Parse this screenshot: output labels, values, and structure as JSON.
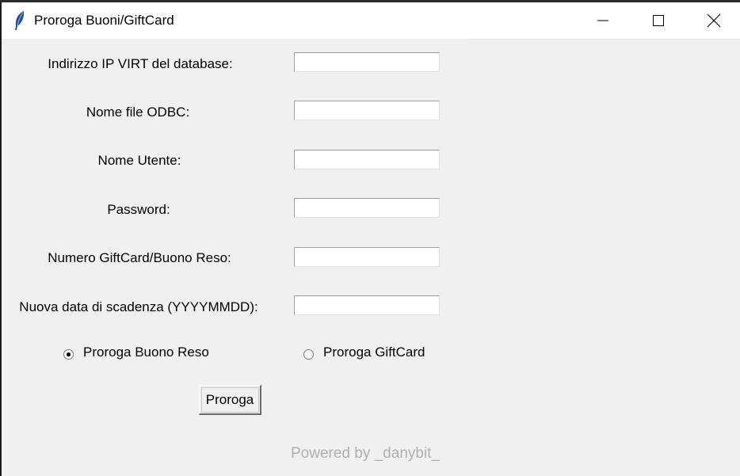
{
  "window": {
    "title": "Proroga Buoni/GiftCard",
    "icon": "feather-icon",
    "controls": [
      "minimize-icon",
      "maximize-icon",
      "close-icon"
    ]
  },
  "form": {
    "fields": [
      {
        "label": "Indirizzo IP VIRT del database:",
        "value": ""
      },
      {
        "label": "Nome file ODBC:",
        "value": ""
      },
      {
        "label": "Nome Utente:",
        "value": ""
      },
      {
        "label": "Password:",
        "value": ""
      },
      {
        "label": "Numero GiftCard/Buono Reso:",
        "value": ""
      },
      {
        "label": "Nuova data di scadenza (YYYYMMDD):",
        "value": ""
      }
    ],
    "radios": [
      {
        "label": "Proroga Buono Reso",
        "selected": true
      },
      {
        "label": "Proroga GiftCard",
        "selected": false
      }
    ],
    "submit_label": "Proroga"
  },
  "footer": {
    "text": "Powered by _danybit_"
  }
}
